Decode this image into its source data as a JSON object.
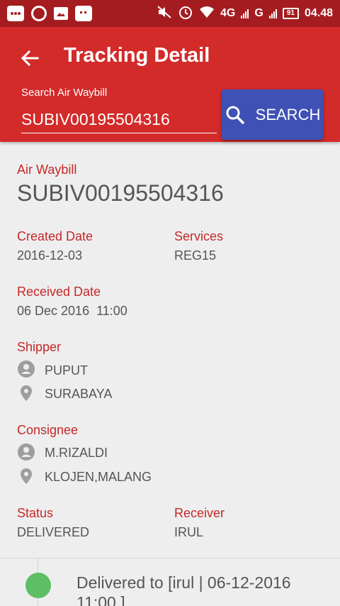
{
  "status_bar": {
    "network": "4G",
    "network2": "G",
    "battery": "91",
    "time": "04.48"
  },
  "appbar": {
    "title": "Tracking Detail",
    "search_label": "Search Air Waybill",
    "search_value": "SUBIV00195504316",
    "search_button": "SEARCH"
  },
  "detail": {
    "awb_label": "Air Waybill",
    "awb_value": "SUBIV00195504316",
    "created_label": "Created Date",
    "created_value": "2016-12-03",
    "services_label": "Services",
    "services_value": "REG15",
    "received_label": "Received Date",
    "received_value": "06 Dec 2016  11:00",
    "shipper_label": "Shipper",
    "shipper_name": "PUPUT",
    "shipper_city": "SURABAYA",
    "consignee_label": "Consignee",
    "consignee_name": "M.RIZALDI",
    "consignee_city": "KLOJEN,MALANG",
    "status_label": "Status",
    "status_value": "DELIVERED",
    "receiver_label": "Receiver",
    "receiver_value": "IRUL"
  },
  "timeline": {
    "entries": [
      {
        "text": "Delivered to [irul | 06-12-2016 11:00 ]",
        "color": "#5cbf63"
      }
    ]
  },
  "colors": {
    "status_bar": "#a51c20",
    "app_bar": "#d32a2a",
    "search_button": "#3f51b5",
    "label_red": "#c62828",
    "delivered_green": "#5cbf63"
  },
  "icons": [
    "back-arrow-icon",
    "search-icon",
    "person-icon",
    "location-pin-icon"
  ]
}
